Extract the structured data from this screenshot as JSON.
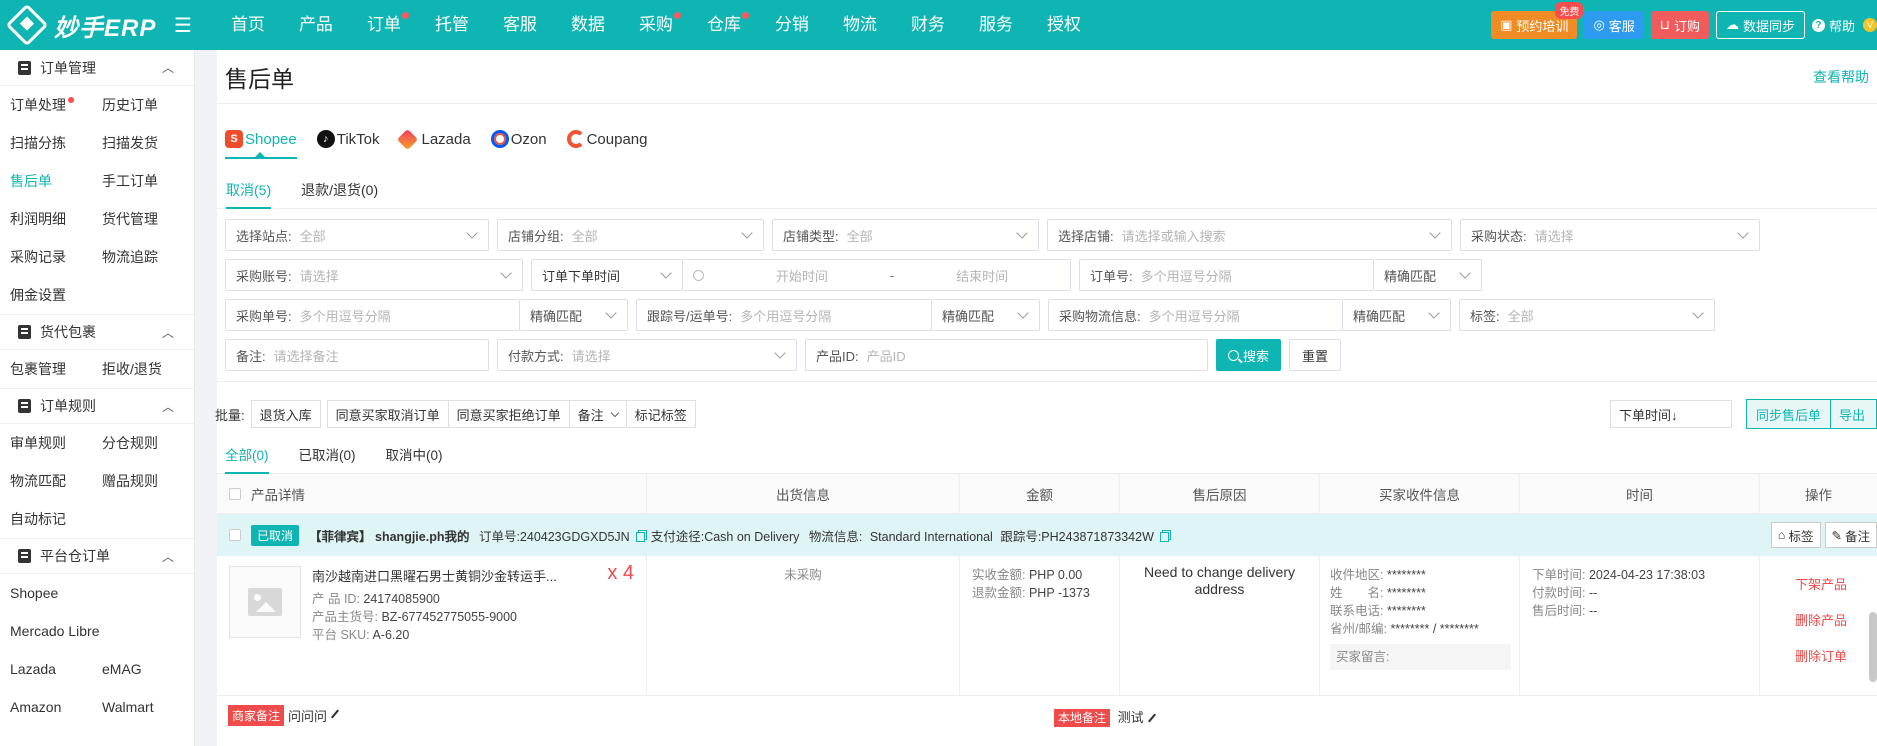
{
  "app": {
    "logo_text": "妙手ERP"
  },
  "nav": {
    "items": [
      {
        "label": "首页",
        "dot": false
      },
      {
        "label": "产品",
        "dot": false
      },
      {
        "label": "订单",
        "dot": true
      },
      {
        "label": "托管",
        "dot": false
      },
      {
        "label": "客服",
        "dot": false
      },
      {
        "label": "数据",
        "dot": false
      },
      {
        "label": "采购",
        "dot": true
      },
      {
        "label": "仓库",
        "dot": true
      },
      {
        "label": "分销",
        "dot": false
      },
      {
        "label": "物流",
        "dot": false
      },
      {
        "label": "财务",
        "dot": false
      },
      {
        "label": "服务",
        "dot": false
      },
      {
        "label": "授权",
        "dot": false
      }
    ],
    "right": {
      "training": "预约培训",
      "free_badge": "免费",
      "service": "客服",
      "buy": "订购",
      "sync": "数据同步",
      "help": "帮助",
      "vip": "V"
    }
  },
  "sidebar": {
    "groups": [
      {
        "title": "订单管理",
        "items": [
          "订单处理",
          "历史订单",
          "扫描分拣",
          "扫描发货",
          "售后单",
          "手工订单",
          "利润明细",
          "货代管理",
          "采购记录",
          "物流追踪",
          "佣金设置"
        ]
      },
      {
        "title": "货代包裹",
        "items": [
          "包裹管理",
          "拒收/退货"
        ]
      },
      {
        "title": "订单规则",
        "items": [
          "审单规则",
          "分仓规则",
          "物流匹配",
          "赠品规则",
          "自动标记"
        ]
      },
      {
        "title": "平台仓订单",
        "items": [
          "Shopee",
          "Mercado Libre",
          "Lazada",
          "eMAG",
          "Amazon",
          "Walmart"
        ]
      }
    ],
    "active_item": "售后单",
    "dot_item": "订单处理"
  },
  "page": {
    "title": "售后单",
    "help_link": "查看帮助"
  },
  "platform_tabs": [
    "Shopee",
    "TikTok",
    "Lazada",
    "Ozon",
    "Coupang"
  ],
  "status_tabs": [
    "取消(5)",
    "退款/退货(0)"
  ],
  "filters": {
    "site": {
      "label": "选择站点:",
      "value": "全部"
    },
    "shop_group": {
      "label": "店铺分组:",
      "value": "全部"
    },
    "shop_type": {
      "label": "店铺类型:",
      "value": "全部"
    },
    "shop": {
      "label": "选择店铺:",
      "placeholder": "请选择或输入搜索"
    },
    "purchase_status": {
      "label": "采购状态:",
      "placeholder": "请选择"
    },
    "purchase_account": {
      "label": "采购账号:",
      "placeholder": "请选择"
    },
    "time_type": "订单下单时间",
    "start_time": "开始时间",
    "time_sep": "-",
    "end_time": "结束时间",
    "order_no": {
      "label": "订单号:",
      "placeholder": "多个用逗号分隔"
    },
    "match_exact": "精确匹配",
    "purchase_no": {
      "label": "采购单号:",
      "placeholder": "多个用逗号分隔"
    },
    "tracking_no": {
      "label": "跟踪号/运单号:",
      "placeholder": "多个用逗号分隔"
    },
    "purchase_logistics": {
      "label": "采购物流信息:",
      "placeholder": "多个用逗号分隔"
    },
    "tag": {
      "label": "标签:",
      "value": "全部"
    },
    "note": {
      "label": "备注:",
      "placeholder": "请选择备注"
    },
    "payment": {
      "label": "付款方式:",
      "placeholder": "请选择"
    },
    "product_id": {
      "label": "产品ID:",
      "placeholder": "产品ID"
    },
    "search": "搜索",
    "reset": "重置"
  },
  "batch": {
    "label": "批量:",
    "buttons": [
      "退货入库",
      "同意买家取消订单",
      "同意买家拒绝订单",
      "备注",
      "标记标签"
    ],
    "sort": "下单时间↓",
    "sync_after": "同步售后单",
    "export": "导出"
  },
  "order_tabs": [
    "全部(0)",
    "已取消(0)",
    "取消中(0)"
  ],
  "table": {
    "headers": [
      "产品详情",
      "出货信息",
      "金额",
      "售后原因",
      "买家收件信息",
      "时间",
      "操作"
    ]
  },
  "order": {
    "status": "已取消",
    "shop_label": "【菲律宾】",
    "shop_name": "shangjie.ph我的",
    "order_no": "订单号:240423GDGXD5JN",
    "payment": "支付途径:Cash on Delivery",
    "logistics": "物流信息:",
    "logistics_val": "Standard International",
    "tracking": "跟踪号:PH243871873342W",
    "tag_btn": "标签",
    "note_btn": "备注",
    "product_title": "南沙越南进口黑曜石男士黄铜沙金转运手...",
    "qty": "x 4",
    "product_id_k": "产 品 ID:",
    "product_id_v": "24174085900",
    "main_sku_k": "产品主货号:",
    "main_sku_v": "BZ-677452775055-9000",
    "platform_sku_k": "平台 SKU:",
    "platform_sku_v": "A-6.20",
    "ship_status": "未采购",
    "paid_k": "实收金额:",
    "paid_v": "PHP 0.00",
    "refund_k": "退款金额:",
    "refund_v": "PHP -1373",
    "reason": "Need to change delivery address",
    "region_k": "收件地区:",
    "region_v": "********",
    "name_k": "姓　　名:",
    "name_v": "********",
    "phone_k": "联系电话:",
    "phone_v": "********",
    "province_k": "省州/邮编:",
    "province_v": "******** / ********",
    "buyer_msg": "买家留言:",
    "order_time_k": "下单时间:",
    "order_time_v": "2024-04-23 17:38:03",
    "pay_time_k": "付款时间:",
    "pay_time_v": "--",
    "after_time_k": "售后时间:",
    "after_time_v": "--",
    "actions": [
      "下架产品",
      "删除产品",
      "删除订单"
    ],
    "merchant_note_tag": "商家备注",
    "merchant_note": "问问问",
    "local_note_tag": "本地备注",
    "local_note": "测试"
  }
}
